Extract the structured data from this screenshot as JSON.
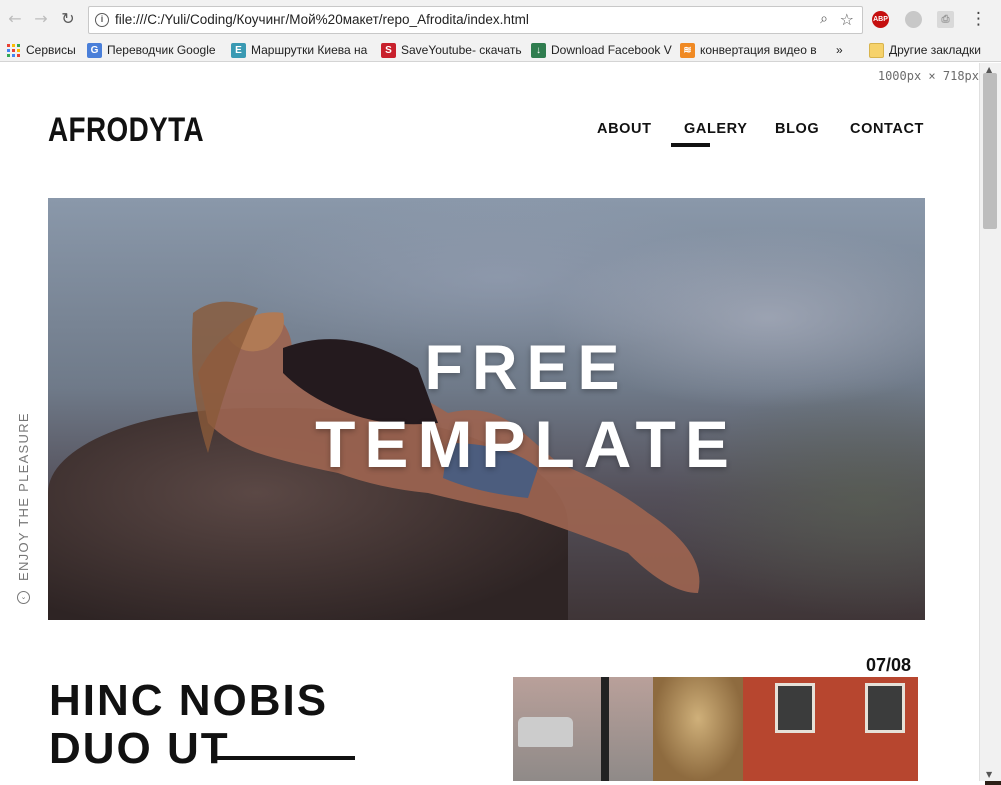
{
  "browser": {
    "url": "file:///C:/Yuli/Coding/Коучинг/Мой%20макет/repo_Afrodita/index.html",
    "bookmarks": [
      "Сервисы",
      "Переводчик Google",
      "Маршрутки Киева на",
      "SaveYoutube- скачать",
      "Download Facebook V",
      "конвертация видео в",
      "»",
      "Другие закладки"
    ],
    "extensions": [
      "ABP"
    ],
    "size_indicator": "1000px × 718px"
  },
  "page": {
    "logo": "AFRODYTA",
    "nav": [
      "ABOUT",
      "GALERY",
      "BLOG",
      "CONTACT"
    ],
    "active_nav": "GALERY",
    "hero_line1": "FREE",
    "hero_line2": "TEMPLATE",
    "side_text": "ENJOY THE PLEASURE",
    "counter": "07/08",
    "heading_line1": "HINC NOBIS",
    "heading_line2": "DUO UT"
  },
  "colors": {
    "abp": "#c50f0f",
    "text": "#111111",
    "muted": "#777777"
  }
}
